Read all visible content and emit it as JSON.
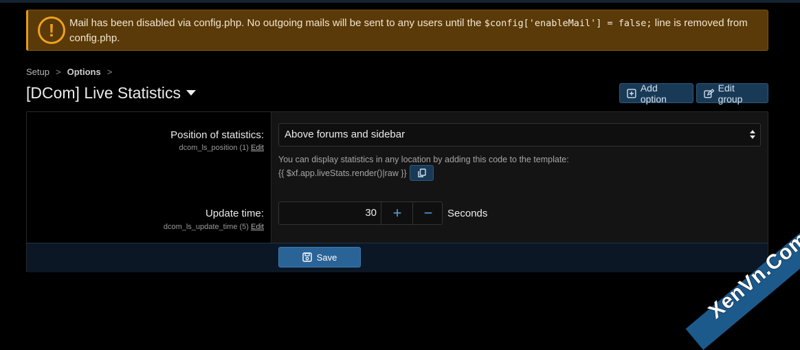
{
  "notice": {
    "icon": "exclamation-circle-icon",
    "text_before": "Mail has been disabled via config.php. No outgoing mails will be sent to any users until the ",
    "code": "$config['enableMail'] = false;",
    "text_after": " line is removed from config.php.",
    "accent_color": "#e69a1a"
  },
  "breadcrumb": {
    "items": [
      "Setup",
      "Options"
    ],
    "separator": ">"
  },
  "page": {
    "title": "[DCom] Live Statistics"
  },
  "toolbar": {
    "add_option_label": "Add option",
    "edit_group_label": "Edit group"
  },
  "options": {
    "position": {
      "label": "Position of statistics:",
      "hint_id": "dcom_ls_position (1)",
      "edit_label": "Edit",
      "selected": "Above forums and sidebar",
      "explain_line1": "You can display statistics in any location by adding this code to the template:",
      "explain_code": "{{ $xf.app.liveStats.render()|raw }}"
    },
    "update_time": {
      "label": "Update time:",
      "hint_id": "dcom_ls_update_time (5)",
      "edit_label": "Edit",
      "value": "30",
      "plus": "+",
      "minus": "−",
      "units": "Seconds"
    }
  },
  "footer": {
    "save_label": "Save"
  },
  "watermark": {
    "text": "XenVn.Com"
  }
}
